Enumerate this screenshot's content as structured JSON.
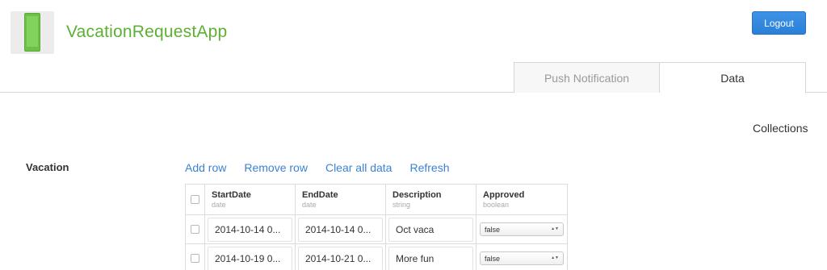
{
  "header": {
    "app_name": "VacationRequestApp",
    "logout_label": "Logout"
  },
  "tabs": [
    {
      "label": "Push Notification",
      "active": false
    },
    {
      "label": "Data",
      "active": true
    }
  ],
  "collections_label": "Collections",
  "section": {
    "title": "Vacation",
    "actions": [
      "Add row",
      "Remove row",
      "Clear all data",
      "Refresh"
    ]
  },
  "table": {
    "columns": [
      {
        "name": "StartDate",
        "type": "date"
      },
      {
        "name": "EndDate",
        "type": "date"
      },
      {
        "name": "Description",
        "type": "string"
      },
      {
        "name": "Approved",
        "type": "boolean"
      }
    ],
    "rows": [
      {
        "start": "2014-10-14 0...",
        "end": "2014-10-14 0...",
        "description": "Oct vaca",
        "approved": "false"
      },
      {
        "start": "2014-10-19 0...",
        "end": "2014-10-21 0...",
        "description": "More fun",
        "approved": "false"
      }
    ]
  },
  "colors": {
    "brand_green": "#5cb034",
    "link_blue": "#3b82d6",
    "button_blue": "#2a7fd8"
  }
}
